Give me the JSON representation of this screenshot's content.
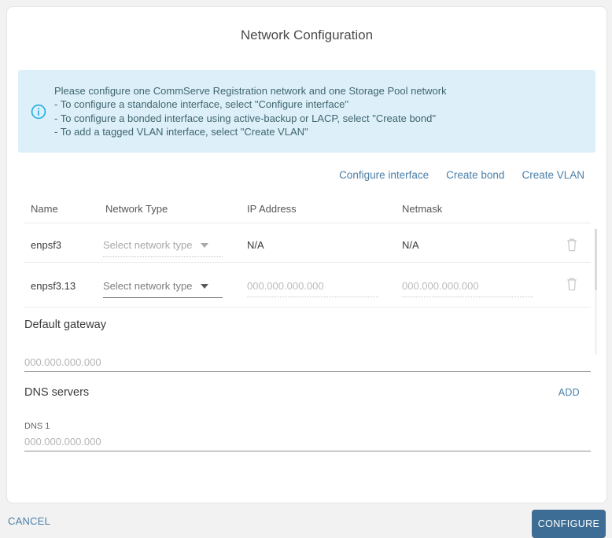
{
  "dialog": {
    "title": "Network Configuration",
    "info": {
      "lines": [
        "Please configure one CommServe Registration network and one Storage Pool network",
        "- To configure a standalone interface, select \"Configure interface\"",
        "- To configure a bonded interface using active-backup or LACP, select \"Create bond\"",
        "- To add a tagged VLAN interface, select \"Create VLAN\""
      ]
    },
    "actions": {
      "configure_interface": "Configure interface",
      "create_bond": "Create bond",
      "create_vlan": "Create VLAN"
    },
    "table": {
      "headers": {
        "name": "Name",
        "network_type": "Network Type",
        "ip_address": "IP Address",
        "netmask": "Netmask"
      },
      "rows": [
        {
          "name": "enpsf3",
          "network_type_placeholder": "Select network type",
          "ip_address": "N/A",
          "netmask": "N/A"
        },
        {
          "name": "enpsf3.13",
          "network_type_placeholder": "Select network type",
          "ip_placeholder": "000.000.000.000",
          "netmask_placeholder": "000.000.000.000"
        }
      ]
    },
    "default_gateway": {
      "label": "Default gateway",
      "placeholder": "000.000.000.000",
      "value": ""
    },
    "dns": {
      "label": "DNS servers",
      "add_label": "ADD",
      "entries": [
        {
          "label": "DNS 1",
          "placeholder": "000.000.000.000",
          "value": ""
        }
      ]
    },
    "footer": {
      "cancel_label": "CANCEL",
      "configure_label": "CONFIGURE"
    },
    "icons": {
      "info": "info-icon",
      "trash": "trash-icon",
      "caret": "chevron-down-icon"
    },
    "colors": {
      "accent_link": "#497fa9",
      "configure_button_bg": "#3d6d94",
      "info_banner_bg": "#ddf0f9",
      "info_icon": "#2caee4",
      "info_text": "#40656f",
      "page_bg": "#f2f2f2"
    }
  }
}
